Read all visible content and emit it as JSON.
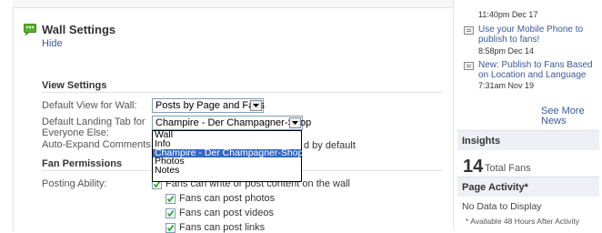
{
  "main": {
    "title": "Wall Settings",
    "hide": "Hide",
    "view_settings": {
      "heading": "View Settings",
      "default_view_label": "Default View for Wall:",
      "default_view_value": "Posts by Page and Fans",
      "landing_tab_label_line1": "Default Landing Tab for",
      "landing_tab_label_line2": "Everyone Else:",
      "landing_tab_value": "Champire - Der Champagner-Shop",
      "dropdown_options": [
        "Wall",
        "Info",
        "Champire - Der Champagner-Shop",
        "Photos",
        "Notes"
      ],
      "dropdown_selected_index": 2,
      "auto_expand_label": "Auto-Expand Comments:",
      "auto_expand_text": "d by default"
    },
    "fan_permissions": {
      "heading": "Fan Permissions",
      "posting_label": "Posting Ability:",
      "posting_options": [
        {
          "label": "Fans can write or post content on the wall",
          "checked": true
        },
        {
          "label": "Fans can post photos",
          "checked": true
        },
        {
          "label": "Fans can post videos",
          "checked": true
        },
        {
          "label": "Fans can post links",
          "checked": true
        }
      ]
    }
  },
  "sidebar": {
    "items": [
      {
        "time": "11:40pm Dec 17"
      },
      {
        "link": "Use your Mobile Phone to publish to fans!",
        "time": "8:58pm Dec 14"
      },
      {
        "link": "New: Publish to Fans Based on Location and Language",
        "time": "7:31am Nov 19"
      }
    ],
    "see_more": "See More News",
    "insights": {
      "heading": "Insights",
      "total_fans_number": "14",
      "total_fans_label": "Total Fans"
    },
    "page_activity": {
      "heading": "Page Activity*",
      "no_data": "No Data to Display",
      "note": "* Available 48 Hours After Activity"
    }
  },
  "colors": {
    "link": "#3b5998",
    "selection": "#3169c6",
    "icon_green": "#5ab12c"
  }
}
